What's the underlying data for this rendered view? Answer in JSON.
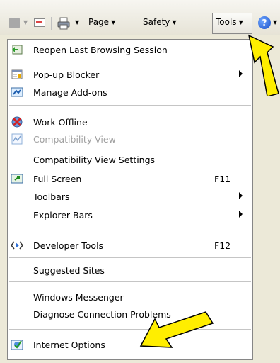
{
  "toolbar": {
    "page_label": "Page",
    "safety_label": "Safety",
    "tools_label": "Tools"
  },
  "menu": {
    "items": [
      {
        "label": "Reopen Last Browsing Session",
        "icon": "reopen-session-icon"
      },
      {
        "label": "Pop-up Blocker",
        "icon": "popup-blocker-icon",
        "submenu": true
      },
      {
        "label": "Manage Add-ons",
        "icon": "addons-icon"
      },
      {
        "label": "Work Offline",
        "icon": "work-offline-icon"
      },
      {
        "label": "Compatibility View",
        "icon": "compatibility-view-icon",
        "disabled": true
      },
      {
        "label": "Compatibility View Settings"
      },
      {
        "label": "Full Screen",
        "icon": "full-screen-icon",
        "shortcut": "F11"
      },
      {
        "label": "Toolbars",
        "submenu": true
      },
      {
        "label": "Explorer Bars",
        "submenu": true
      },
      {
        "label": "Developer Tools",
        "icon": "developer-tools-icon",
        "shortcut": "F12"
      },
      {
        "label": "Suggested Sites"
      },
      {
        "label": "Windows Messenger"
      },
      {
        "label": "Diagnose Connection Problems"
      },
      {
        "label": "Internet Options",
        "icon": "internet-options-icon"
      }
    ]
  },
  "colors": {
    "callout_arrow": "#ffee00",
    "disabled_text": "#a0a0a0"
  }
}
